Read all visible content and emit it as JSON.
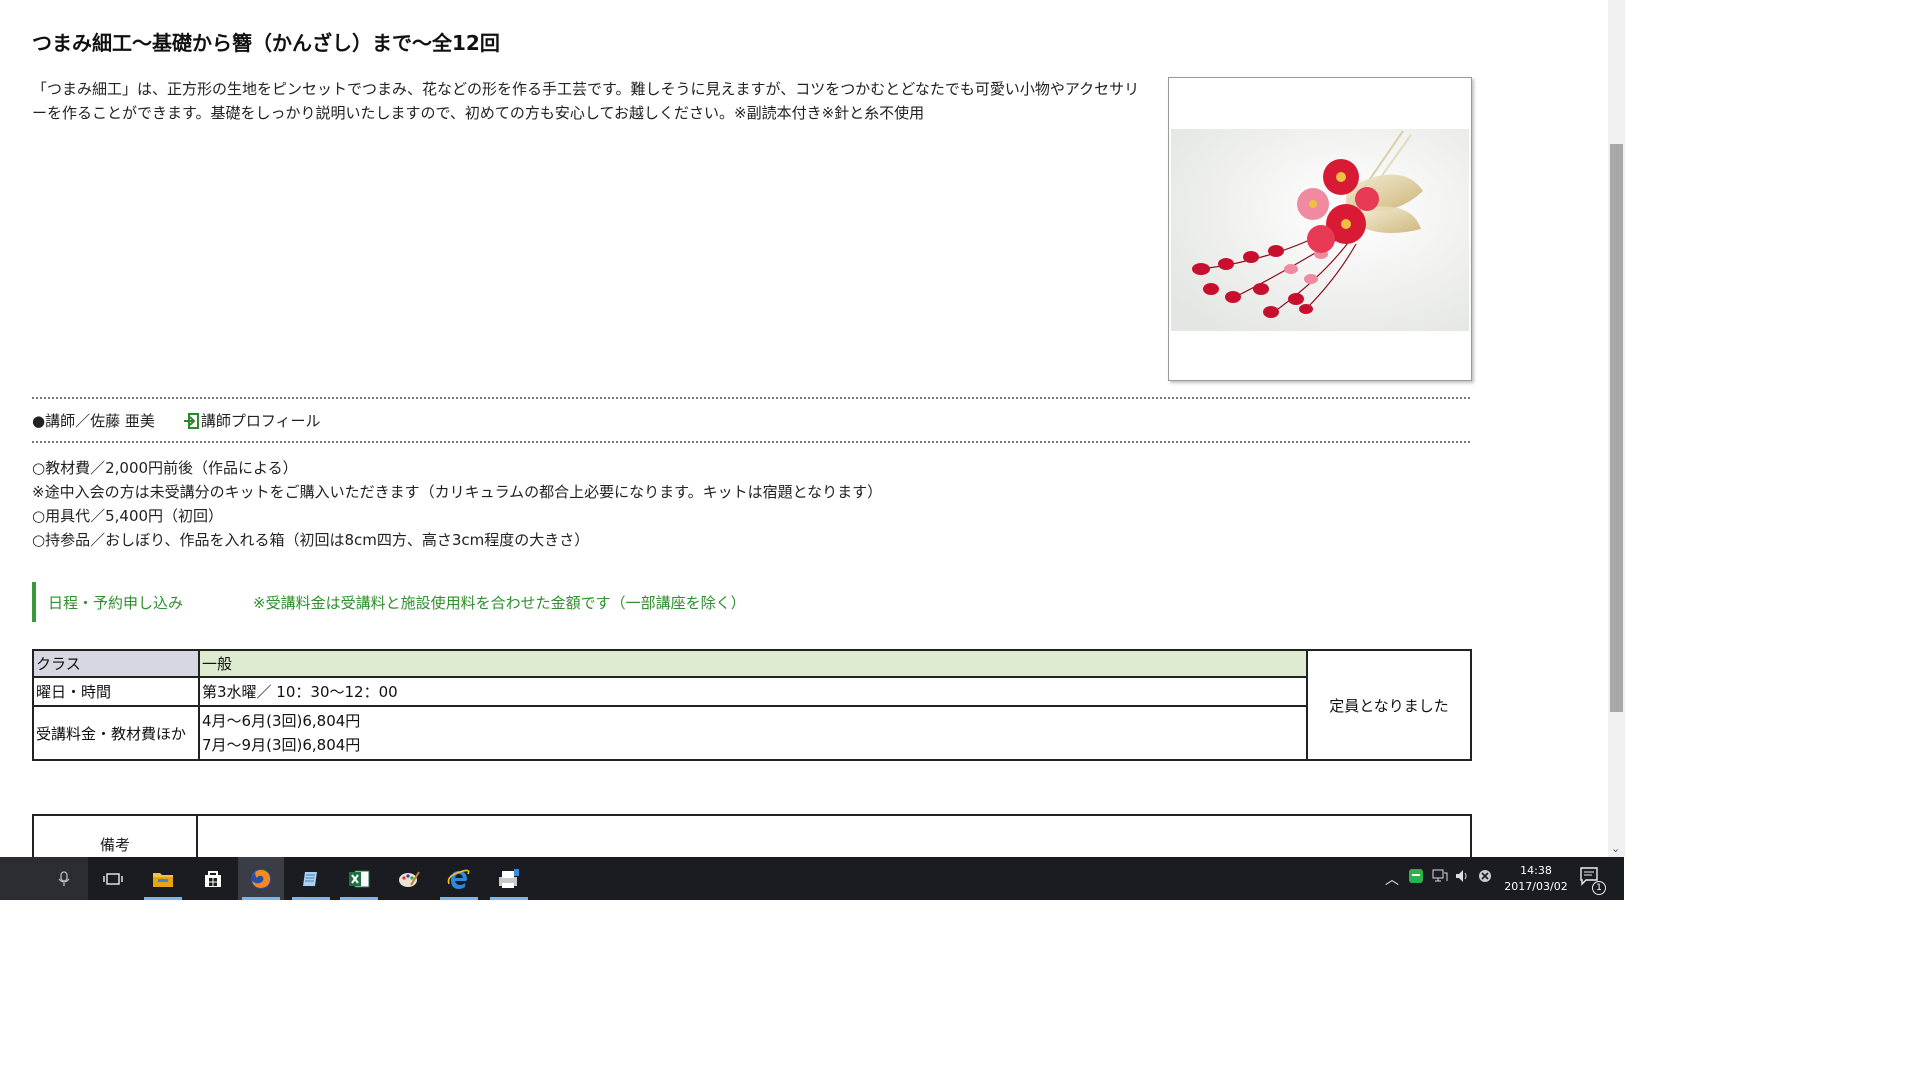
{
  "course": {
    "title": "つまみ細工〜基礎から簪（かんざし）まで〜全12回",
    "description": "「つまみ細工」は、正方形の生地をピンセットでつまみ、花などの形を作る手工芸です。難しそうに見えますが、コツをつかむとどなたでも可愛い小物やアクセサリーを作ることができます。基礎をしっかり説明いたしますので、初めての方も安心してお越しください。※副読本付き※針と糸不使用",
    "instructor": "●講師／佐藤 亜美",
    "profile_link": "講師プロフィール",
    "notes": [
      "○教材費／2,000円前後（作品による）",
      "※途中入会の方は未受講分のキットをご購入いただきます（カリキュラムの都合上必要になります。キットは宿題となります）",
      "○用具代／5,400円（初回）",
      "○持参品／おしぼり、作品を入れる箱（初回は8cm四方、高さ3cm程度の大きさ）"
    ]
  },
  "schedule": {
    "heading": "日程・予約申し込み",
    "fee_note": "※受講料金は受講料と施設使用料を合わせた金額です（一部講座を除く）",
    "class_label": "クラス",
    "class_value": "一般",
    "time_label": "曜日・時間",
    "time_value": "第3水曜／ 10：30〜12：00",
    "fee_label": "受講料金・教材費ほか",
    "fee_lines": [
      "4月〜6月(3回)6,804円",
      "7月〜9月(3回)6,804円"
    ],
    "status": "定員となりました",
    "remarks_label": "備考"
  },
  "taskbar": {
    "icons": [
      "microphone-icon",
      "task-view-icon",
      "file-explorer-icon",
      "store-icon",
      "firefox-icon",
      "notepad-icon",
      "excel-icon",
      "paint-icon",
      "internet-explorer-icon",
      "printer-icon"
    ],
    "time": "14:38",
    "date": "2017/03/02",
    "notification_count": "1"
  },
  "colors": {
    "accent_green": "#2f8f2f",
    "class_bg": "#deebd1",
    "label_bg": "#d7d7e2",
    "taskbar": "#1a1c22"
  }
}
